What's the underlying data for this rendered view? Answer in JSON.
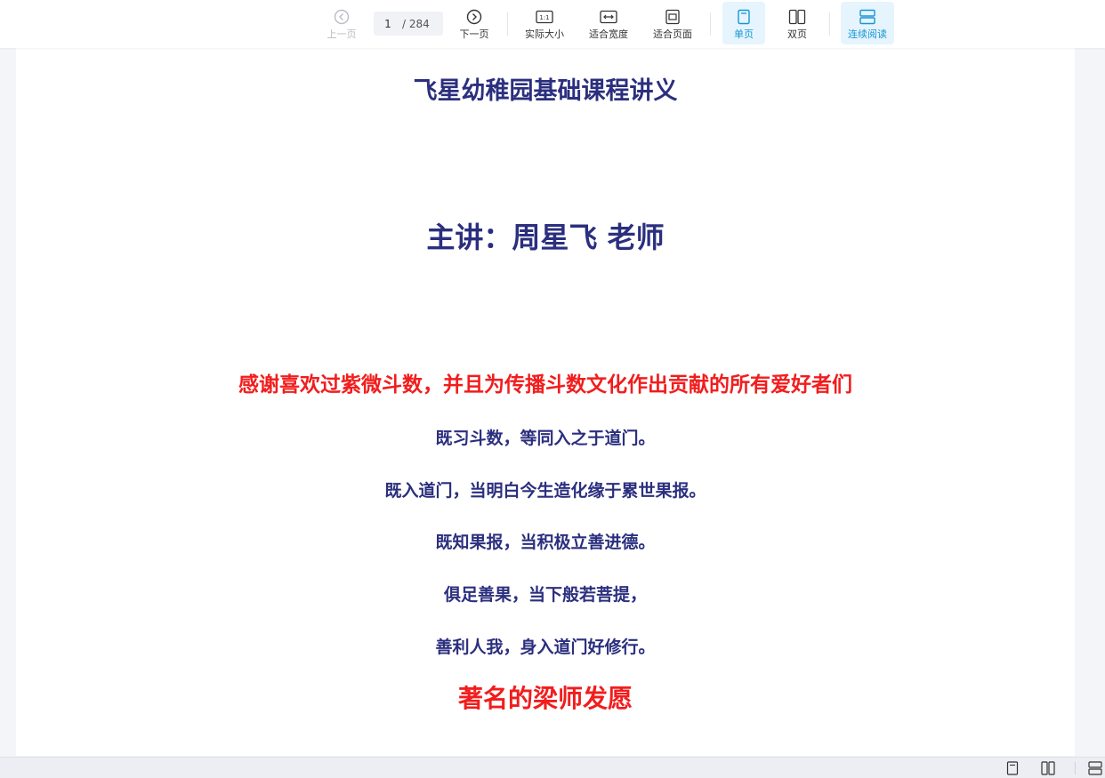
{
  "toolbar": {
    "prev_label": "上一页",
    "page_current": "1",
    "page_total": "/ 284",
    "next_label": "下一页",
    "actual_size_label": "实际大小",
    "fit_width_label": "适合宽度",
    "fit_page_label": "适合页面",
    "single_page_label": "单页",
    "double_page_label": "双页",
    "continuous_label": "连续阅读",
    "actual_size_icon_text": "1:1"
  },
  "document": {
    "title": "飞星幼稚园基础课程讲义",
    "lecturer": "主讲：周星飞 老师",
    "thanks": "感谢喜欢过紫微斗数，并且为传播斗数文化作出贡献的所有爱好者们",
    "verses": [
      "既习斗数，等同入之于道门。",
      "既入道门，当明白今生造化缘于累世果报。",
      "既知果报，当积极立善进德。",
      "俱足善果，当下般若菩提，",
      "善利人我，身入道门好修行。"
    ],
    "vow_heading": "著名的梁师发愿"
  },
  "colors": {
    "accent": "#1795d4",
    "accent_bg": "#e6f5fd",
    "navy_text": "#2b2f7e",
    "red_text": "#f21d1d",
    "disabled": "#b9bcc4"
  },
  "icons": {
    "prev": "circle-chevron-left-icon",
    "next": "circle-chevron-right-icon",
    "actual_size": "one-to-one-icon",
    "fit_width": "fit-width-icon",
    "fit_page": "fit-page-icon",
    "single_page": "single-page-icon",
    "double_page": "double-page-icon",
    "continuous": "continuous-reading-icon"
  }
}
